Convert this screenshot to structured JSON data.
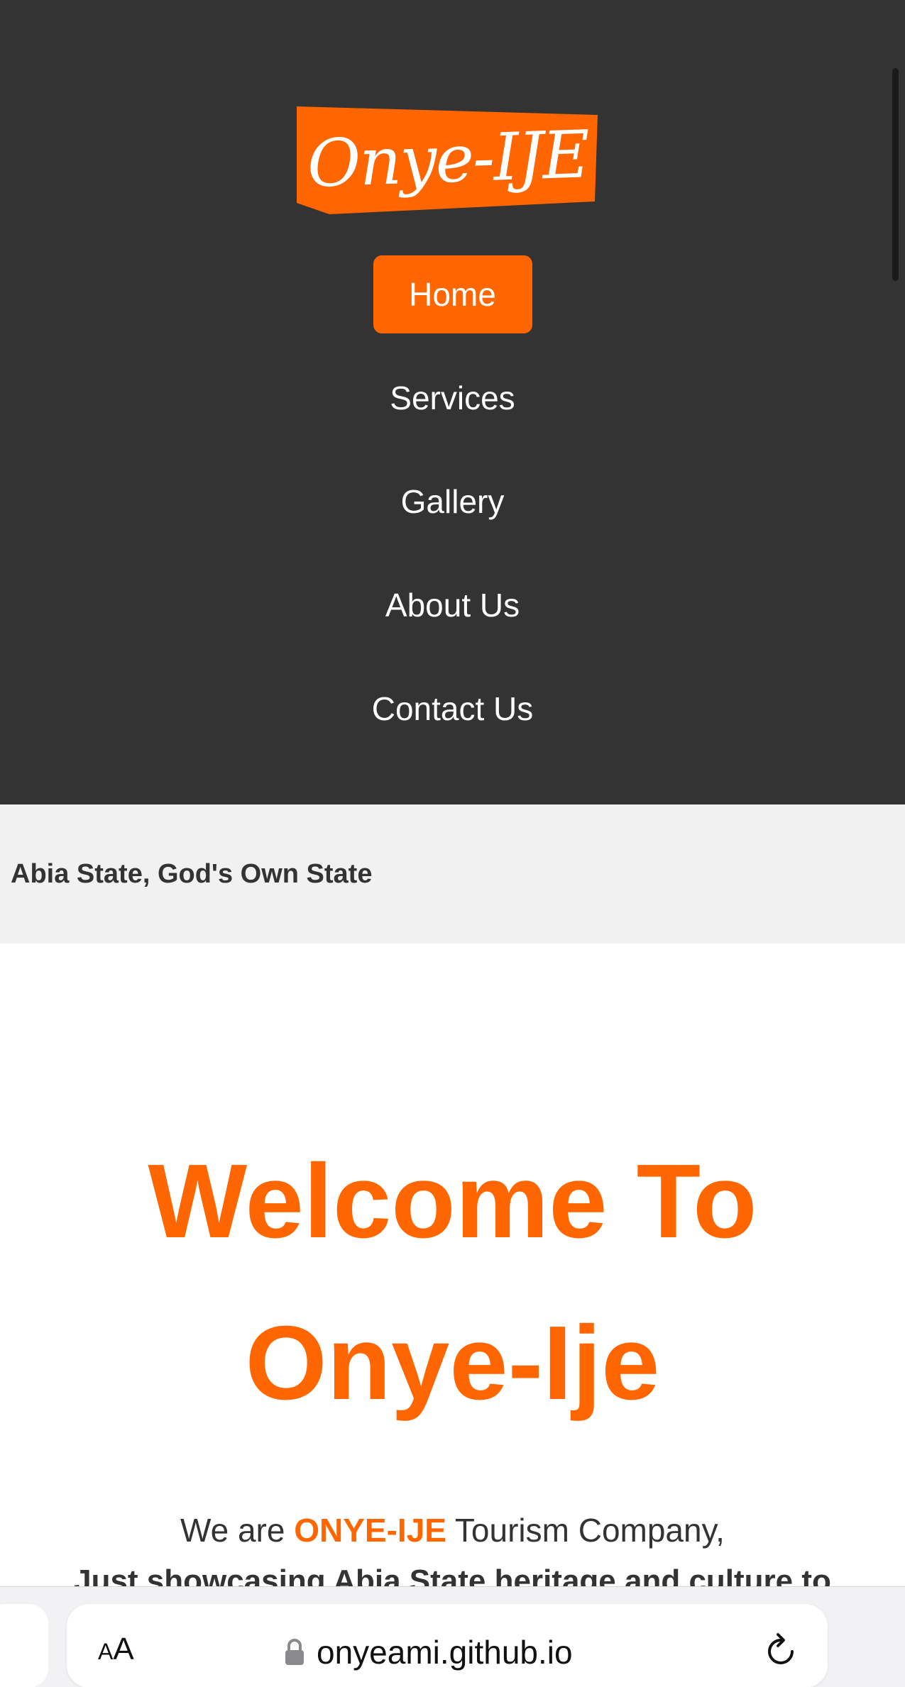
{
  "header": {
    "logo_text": "Onye-IJE",
    "nav": [
      {
        "label": "Home",
        "active": true
      },
      {
        "label": "Services",
        "active": false
      },
      {
        "label": "Gallery",
        "active": false
      },
      {
        "label": "About Us",
        "active": false
      },
      {
        "label": "Contact Us",
        "active": false
      }
    ]
  },
  "tagline": "Abia State, God's Own State",
  "welcome": {
    "line1": "Welcome To",
    "line2": "Onye-Ije"
  },
  "intro": {
    "prefix": "We are ",
    "brand": "ONYE-IJE",
    "suffix": " Tourism Company,",
    "line2": "Just showcasing Abia State heritage and culture to"
  },
  "browser": {
    "text_size_small": "A",
    "text_size_big": "A",
    "url": "onyeami.github.io",
    "icons": [
      "lock-icon",
      "reload-icon"
    ]
  },
  "colors": {
    "accent": "#ff6600",
    "header_bg": "#333333",
    "tagline_bg": "#f1f1f1",
    "text": "#333333"
  }
}
